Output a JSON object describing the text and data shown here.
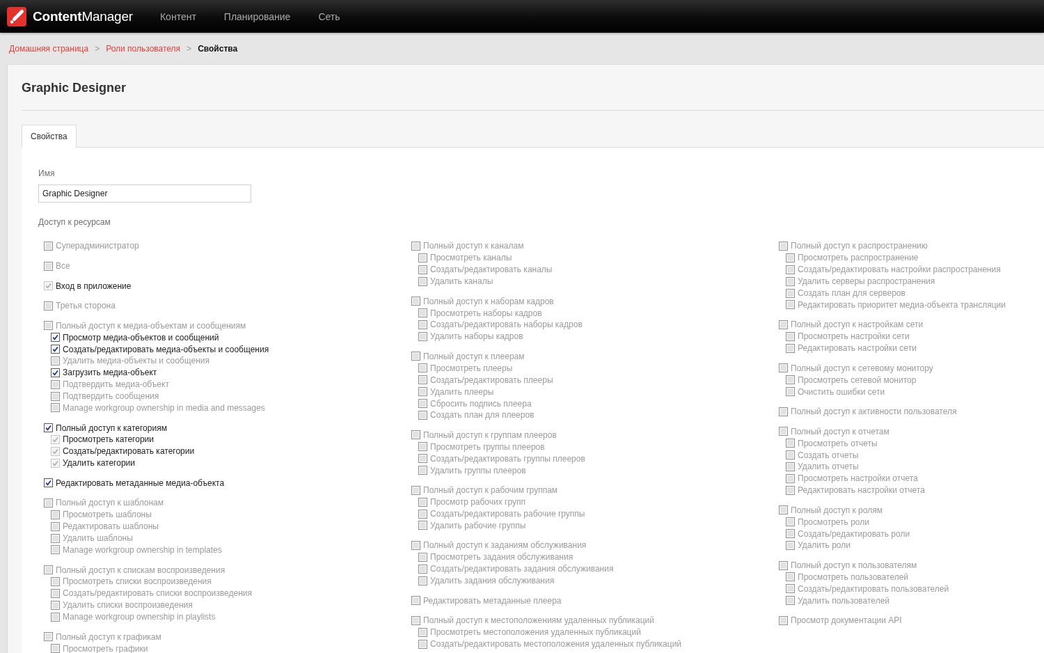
{
  "app": {
    "logo": "**Content**Manager",
    "nav": [
      {
        "label": "Контент"
      },
      {
        "label": "Планирование"
      },
      {
        "label": "Сеть"
      }
    ]
  },
  "breadcrumb": [
    {
      "kind": "link",
      "label": "Домашняя страница"
    },
    {
      "kind": "separator",
      "label": ">"
    },
    {
      "kind": "link",
      "label": "Роли пользователя"
    },
    {
      "kind": "separator",
      "label": ">"
    },
    {
      "kind": "current",
      "label": "Свойства"
    }
  ],
  "page": {
    "title": "Graphic Designer"
  },
  "tabs": [
    {
      "label": "Свойства",
      "selected": true
    }
  ],
  "form": {
    "name_label": "Имя",
    "name_value": "Graphic Designer"
  },
  "permissions": {
    "label": "Доступ к ресурсам",
    "columns": [
      {
        "items": [
          {
            "label": "Суперадминистратор",
            "checked": false,
            "disabled": false
          },
          {
            "label": "Все",
            "checked": false,
            "disabled": false
          },
          {
            "label": "Вход в приложение",
            "checked": true,
            "disabled": true
          },
          {
            "label": "Третья сторона",
            "checked": false,
            "disabled": false
          },
          {
            "label": "Полный доступ к медиа-объектам и сообщениям",
            "checked": false,
            "disabled": false,
            "children": [
              {
                "label": "Просмотр медиа-объектов и сообщений",
                "checked": true,
                "disabled": false
              },
              {
                "label": "Создать/редактировать медиа-объекты и сообщения",
                "checked": true,
                "disabled": false
              },
              {
                "label": "Удалить медиа-объекты и сообщения",
                "checked": false,
                "disabled": false
              },
              {
                "label": "Загрузить медиа-объект",
                "checked": true,
                "disabled": false
              },
              {
                "label": "Подтвердить медиа-объект",
                "checked": false,
                "disabled": false
              },
              {
                "label": "Подтвердить сообщения",
                "checked": false,
                "disabled": false
              },
              {
                "label": "Manage workgroup ownership in media and messages",
                "checked": false,
                "disabled": false
              }
            ]
          },
          {
            "label": "Полный доступ к категориям",
            "checked": true,
            "disabled": false,
            "children": [
              {
                "label": "Просмотреть категории",
                "checked": true,
                "disabled": true
              },
              {
                "label": "Создать/редактировать категории",
                "checked": true,
                "disabled": true
              },
              {
                "label": "Удалить категории",
                "checked": true,
                "disabled": true
              }
            ]
          },
          {
            "label": "Редактировать метаданные медиа-объекта",
            "checked": true,
            "disabled": false
          },
          {
            "label": "Полный доступ к шаблонам",
            "checked": false,
            "disabled": false,
            "children": [
              {
                "label": "Просмотреть шаблоны",
                "checked": false,
                "disabled": false
              },
              {
                "label": "Редактировать шаблоны",
                "checked": false,
                "disabled": false
              },
              {
                "label": "Удалить шаблоны",
                "checked": false,
                "disabled": false
              },
              {
                "label": "Manage workgroup ownership in templates",
                "checked": false,
                "disabled": false
              }
            ]
          },
          {
            "label": "Полный доступ к спискам воспроизведения",
            "checked": false,
            "disabled": false,
            "children": [
              {
                "label": "Просмотреть списки воспроизведения",
                "checked": false,
                "disabled": false
              },
              {
                "label": "Создать/редактировать списки воспроизведения",
                "checked": false,
                "disabled": false
              },
              {
                "label": "Удалить списки воспроизведения",
                "checked": false,
                "disabled": false
              },
              {
                "label": "Manage workgroup ownership in playlists",
                "checked": false,
                "disabled": false
              }
            ]
          },
          {
            "label": "Полный доступ к графикам",
            "checked": false,
            "disabled": false,
            "children": [
              {
                "label": "Просмотреть графики",
                "checked": false,
                "disabled": false
              }
            ]
          }
        ]
      },
      {
        "items": [
          {
            "label": "Полный доступ к каналам",
            "checked": false,
            "disabled": false,
            "children": [
              {
                "label": "Просмотреть каналы",
                "checked": false,
                "disabled": false
              },
              {
                "label": "Создать/редактировать каналы",
                "checked": false,
                "disabled": false
              },
              {
                "label": "Удалить каналы",
                "checked": false,
                "disabled": false
              }
            ]
          },
          {
            "label": "Полный доступ к наборам кадров",
            "checked": false,
            "disabled": false,
            "children": [
              {
                "label": "Просмотреть наборы кадров",
                "checked": false,
                "disabled": false
              },
              {
                "label": "Создать/редактировать наборы кадров",
                "checked": false,
                "disabled": false
              },
              {
                "label": "Удалить наборы кадров",
                "checked": false,
                "disabled": false
              }
            ]
          },
          {
            "label": "Полный доступ к плеерам",
            "checked": false,
            "disabled": false,
            "children": [
              {
                "label": "Просмотреть плееры",
                "checked": false,
                "disabled": false
              },
              {
                "label": "Создать/редактировать плееры",
                "checked": false,
                "disabled": false
              },
              {
                "label": "Удалить плееры",
                "checked": false,
                "disabled": false
              },
              {
                "label": "Сбросить подпись плеера",
                "checked": false,
                "disabled": false
              },
              {
                "label": "Создать план для плееров",
                "checked": false,
                "disabled": false
              }
            ]
          },
          {
            "label": "Полный доступ к группам плееров",
            "checked": false,
            "disabled": false,
            "children": [
              {
                "label": "Просмотреть группы плееров",
                "checked": false,
                "disabled": false
              },
              {
                "label": "Создать/редактировать группы плееров",
                "checked": false,
                "disabled": false
              },
              {
                "label": "Удалить группы плееров",
                "checked": false,
                "disabled": false
              }
            ]
          },
          {
            "label": "Полный доступ к рабочим группам",
            "checked": false,
            "disabled": false,
            "children": [
              {
                "label": "Просмотр рабочих групп",
                "checked": false,
                "disabled": false
              },
              {
                "label": "Создать/редактировать рабочие группы",
                "checked": false,
                "disabled": false
              },
              {
                "label": "Удалить рабочие группы",
                "checked": false,
                "disabled": false
              }
            ]
          },
          {
            "label": "Полный доступ к заданиям обслуживания",
            "checked": false,
            "disabled": false,
            "children": [
              {
                "label": "Просмотреть задания обслуживания",
                "checked": false,
                "disabled": false
              },
              {
                "label": "Создать/редактировать задания обслуживания",
                "checked": false,
                "disabled": false
              },
              {
                "label": "Удалить задания обслуживания",
                "checked": false,
                "disabled": false
              }
            ]
          },
          {
            "label": "Редактировать метаданные плеера",
            "checked": false,
            "disabled": false
          },
          {
            "label": "Полный доступ к местоположениям удаленных публикаций",
            "checked": false,
            "disabled": false,
            "children": [
              {
                "label": "Просмотреть местоположения удаленных публикаций",
                "checked": false,
                "disabled": false
              },
              {
                "label": "Создать/редактировать местоположения удаленных публикаций",
                "checked": false,
                "disabled": false
              }
            ]
          }
        ]
      },
      {
        "items": [
          {
            "label": "Полный доступ к распространению",
            "checked": false,
            "disabled": false,
            "children": [
              {
                "label": "Просмотреть распространение",
                "checked": false,
                "disabled": false
              },
              {
                "label": "Создать/редактировать настройки распространения",
                "checked": false,
                "disabled": false
              },
              {
                "label": "Удалить серверы распространения",
                "checked": false,
                "disabled": false
              },
              {
                "label": "Создать план для серверов",
                "checked": false,
                "disabled": false
              },
              {
                "label": "Редактировать приоритет медиа-объекта трансляции",
                "checked": false,
                "disabled": false
              }
            ]
          },
          {
            "label": "Полный доступ к настройкам сети",
            "checked": false,
            "disabled": false,
            "children": [
              {
                "label": "Просмотреть настройки сети",
                "checked": false,
                "disabled": false
              },
              {
                "label": "Редактировать настройки сети",
                "checked": false,
                "disabled": false
              }
            ]
          },
          {
            "label": "Полный доступ к сетевому монитору",
            "checked": false,
            "disabled": false,
            "children": [
              {
                "label": "Просмотреть сетевой монитор",
                "checked": false,
                "disabled": false
              },
              {
                "label": "Очистить ошибки сети",
                "checked": false,
                "disabled": false
              }
            ]
          },
          {
            "label": "Полный доступ к активности пользователя",
            "checked": false,
            "disabled": false
          },
          {
            "label": "Полный доступ к отчетам",
            "checked": false,
            "disabled": false,
            "children": [
              {
                "label": "Просмотреть отчеты",
                "checked": false,
                "disabled": false
              },
              {
                "label": "Создать отчеты",
                "checked": false,
                "disabled": false
              },
              {
                "label": "Удалить отчеты",
                "checked": false,
                "disabled": false
              },
              {
                "label": "Просмотреть настройки отчета",
                "checked": false,
                "disabled": false
              },
              {
                "label": "Редактировать настройки отчета",
                "checked": false,
                "disabled": false
              }
            ]
          },
          {
            "label": "Полный доступ к ролям",
            "checked": false,
            "disabled": false,
            "children": [
              {
                "label": "Просмотреть роли",
                "checked": false,
                "disabled": false
              },
              {
                "label": "Создать/редактировать роли",
                "checked": false,
                "disabled": false
              },
              {
                "label": "Удалить роли",
                "checked": false,
                "disabled": false
              }
            ]
          },
          {
            "label": "Полный доступ к пользователям",
            "checked": false,
            "disabled": false,
            "children": [
              {
                "label": "Просмотреть пользователей",
                "checked": false,
                "disabled": false
              },
              {
                "label": "Создать/редактировать пользователей",
                "checked": false,
                "disabled": false
              },
              {
                "label": "Удалить пользователей",
                "checked": false,
                "disabled": false
              }
            ]
          },
          {
            "label": "Просмотр документации API",
            "checked": false,
            "disabled": false
          }
        ]
      }
    ]
  }
}
